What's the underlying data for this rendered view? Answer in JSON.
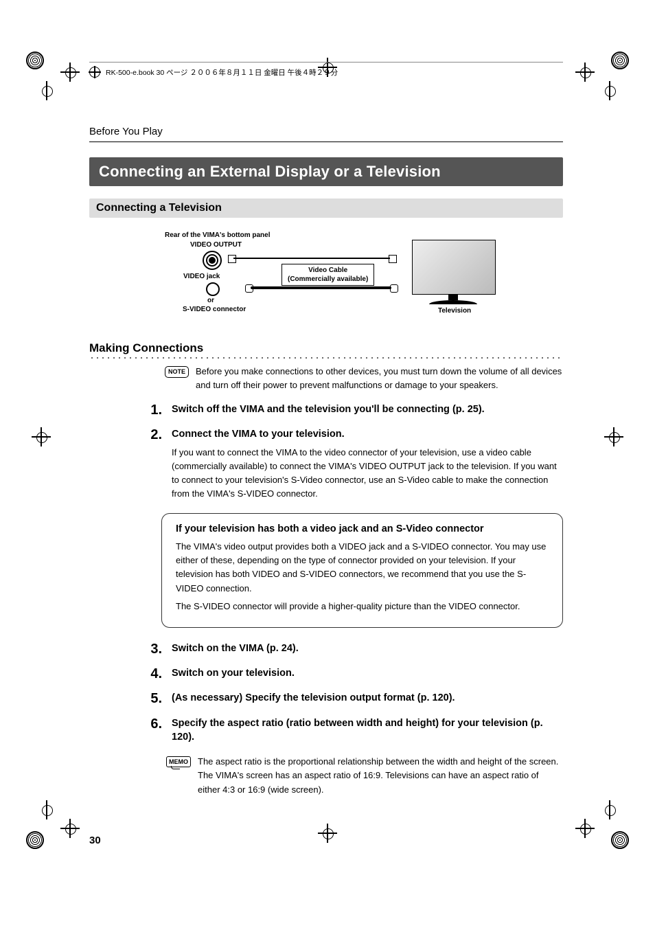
{
  "header_line": "RK-500-e.book 30 ページ ２００６年８月１１日 金曜日 午後４時２９分",
  "breadcrumb": "Before You Play",
  "section_title": "Connecting an External Display or a Television",
  "subsection_title": "Connecting a Television",
  "diagram": {
    "rear_label": "Rear of the VIMA's bottom panel",
    "video_output": "VIDEO OUTPUT",
    "video_jack": "VIDEO jack",
    "or": "or",
    "svideo_conn": "S-VIDEO connector",
    "cable_line1": "Video Cable",
    "cable_line2": "(Commercially available)",
    "tv_label": "Television"
  },
  "making_connections_heading": "Making Connections",
  "note_label": "NOTE",
  "note_text": "Before you make connections to other devices, you must turn down the volume of all devices and turn off their power to prevent malfunctions or damage to your speakers.",
  "steps": [
    {
      "num": "1",
      "title": "Switch off the VIMA and the television you'll be connecting (p. 25).",
      "text": ""
    },
    {
      "num": "2",
      "title": "Connect the VIMA to your television.",
      "text": "If you want to connect the VIMA to the video connector of your television, use a video cable (commercially available) to connect the VIMA's VIDEO OUTPUT jack to the television. If you want to connect to your television's S-Video connector, use an S-Video cable to make the connection from the VIMA's S-VIDEO connector."
    },
    {
      "num": "3",
      "title": "Switch on the VIMA (p. 24).",
      "text": ""
    },
    {
      "num": "4",
      "title": "Switch on your television.",
      "text": ""
    },
    {
      "num": "5",
      "title": "(As necessary) Specify the television output format (p. 120).",
      "text": ""
    },
    {
      "num": "6",
      "title": "Specify the aspect ratio (ratio between width and height) for your television (p. 120).",
      "text": ""
    }
  ],
  "callout": {
    "title": "If your television has both a video jack and an S-Video connector",
    "text1": "The VIMA's video output provides both a VIDEO jack and a S-VIDEO connector. You may use either of these, depending on the type of connector provided on your television. If your television has both VIDEO and S-VIDEO connectors, we recommend that you use the S-VIDEO connection.",
    "text2": "The S-VIDEO connector will provide a higher-quality picture than the VIDEO connector."
  },
  "memo_label": "MEMO",
  "memo_text": "The aspect ratio is the proportional relationship between the width and height of the screen. The VIMA's screen has an aspect ratio of 16:9. Televisions can have an aspect ratio of either 4:3 or 16:9 (wide screen).",
  "page_number": "30"
}
